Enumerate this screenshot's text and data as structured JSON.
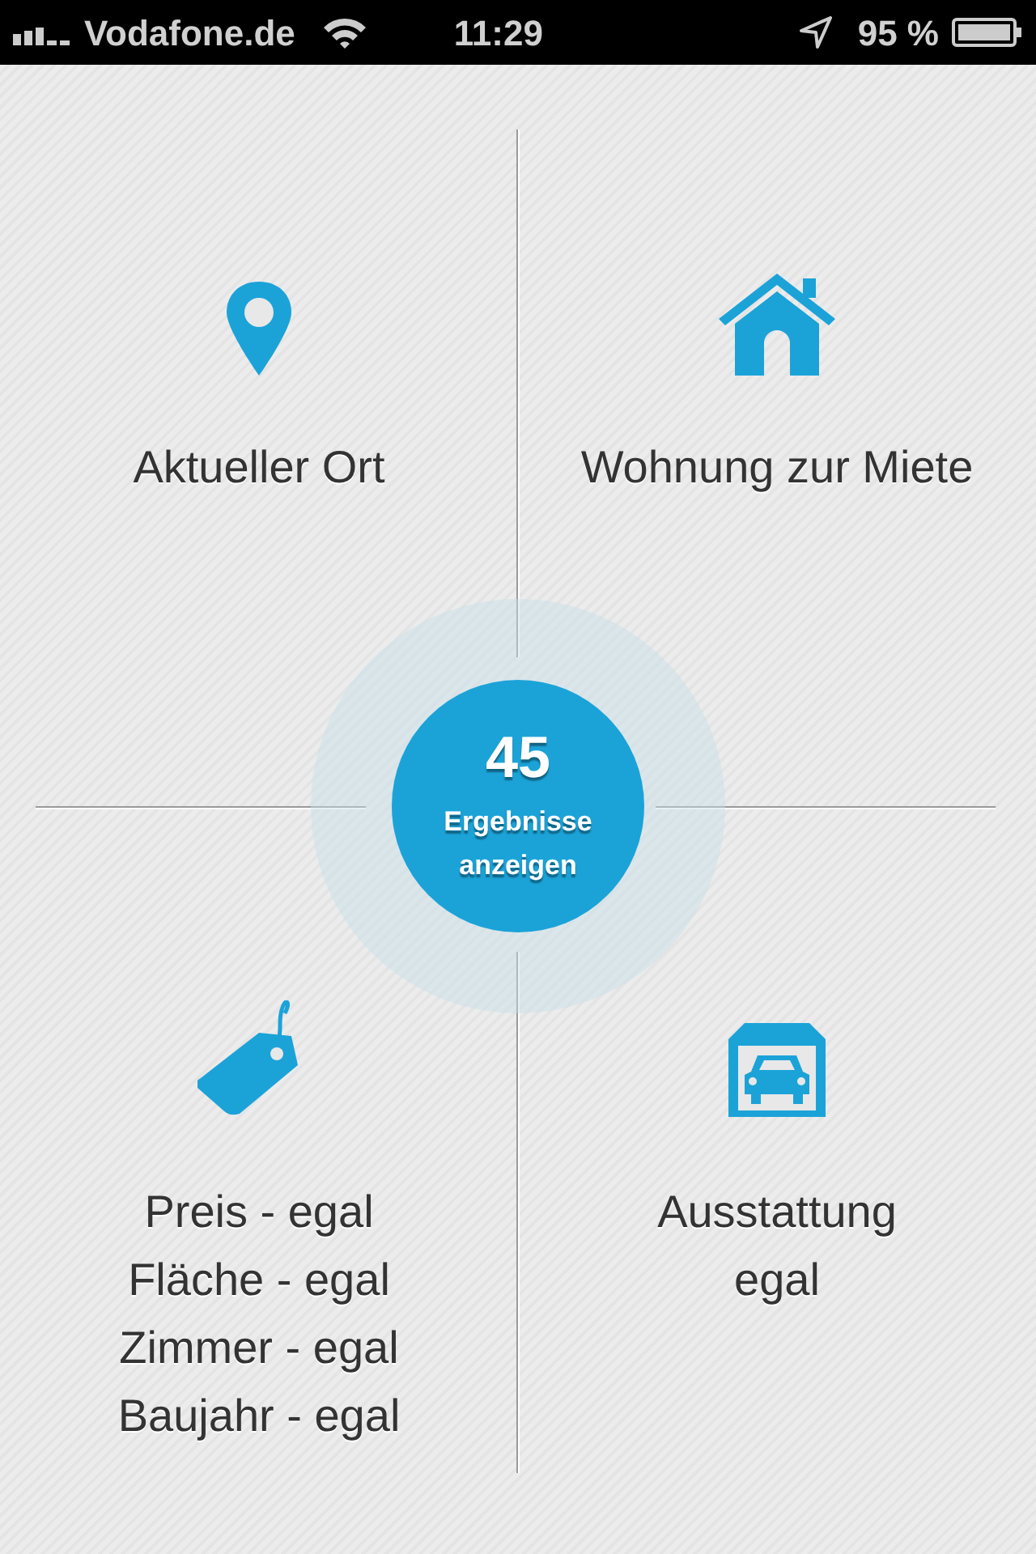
{
  "status_bar": {
    "carrier": "Vodafone.de",
    "time": "11:29",
    "battery": "95 %"
  },
  "tiles": [
    {
      "kind": "location",
      "lines": [
        "Aktueller Ort"
      ]
    },
    {
      "kind": "property_type",
      "lines": [
        "Wohnung zur Miete"
      ]
    },
    {
      "kind": "filters",
      "lines": [
        "Preis - egal",
        "Fläche - egal",
        "Zimmer - egal",
        "Baujahr - egal"
      ]
    },
    {
      "kind": "features",
      "lines": [
        "Ausstattung",
        "egal"
      ]
    }
  ],
  "results_button": {
    "count": "45",
    "label": "Ergebnisse anzeigen"
  }
}
